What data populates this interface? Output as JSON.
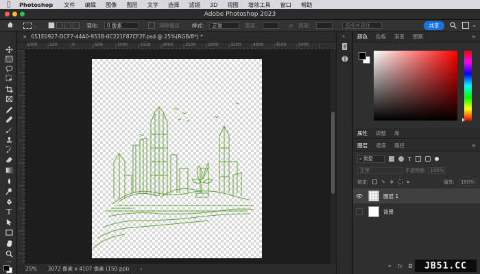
{
  "menubar": {
    "app_name": "Photoshop",
    "items": [
      "文件",
      "编辑",
      "图像",
      "图层",
      "文字",
      "选择",
      "滤镜",
      "3D",
      "视图",
      "增效工具",
      "窗口",
      "帮助"
    ]
  },
  "window": {
    "title": "Adobe Photoshop 2023"
  },
  "options": {
    "feather_label": "羽化:",
    "feather_value": "0 像素",
    "antialias_label": "消除锯齿",
    "style_label": "样式:",
    "style_value": "正常",
    "width_label": "宽度:",
    "height_label": "高度:",
    "select_subject": "选择并遮住...",
    "share_label": "共享"
  },
  "document": {
    "tab_title": "051E0927-DCF7-44A0-953B-0C221F87CF2F.psd @ 25%(RGB/8*) *",
    "zoom": "25%",
    "size_info": "3072 像素 x 4107 像素 (150 ppi)"
  },
  "ruler": {
    "ticks": [
      "1000",
      "500",
      "0",
      "500",
      "1000",
      "1500",
      "2000",
      "2500",
      "3000",
      "3500",
      "4000",
      "4500",
      "5000"
    ]
  },
  "color_panel": {
    "tabs": [
      "颜色",
      "色板",
      "渐变",
      "图案"
    ],
    "active_tab": 0,
    "hue_color": "#ff0000",
    "fg_color": "#000000",
    "bg_color": "#ffffff"
  },
  "props_panel": {
    "tabs": [
      "属性",
      "调整",
      "库"
    ]
  },
  "layers_panel": {
    "tabs": [
      "图层",
      "通道",
      "路径"
    ],
    "filter_label": "类型",
    "blend_mode": "正常",
    "opacity_label": "不透明度:",
    "opacity_value": "100%",
    "lock_label": "锁定:",
    "fill_label": "填充:",
    "fill_value": "100%",
    "layers": [
      {
        "name": "图层 1",
        "visible": true
      },
      {
        "name": "背景",
        "visible": false
      }
    ]
  },
  "watermark": "JB51.CC",
  "colors": {
    "accent": "#1473e6",
    "sketch": "#63a63a"
  }
}
